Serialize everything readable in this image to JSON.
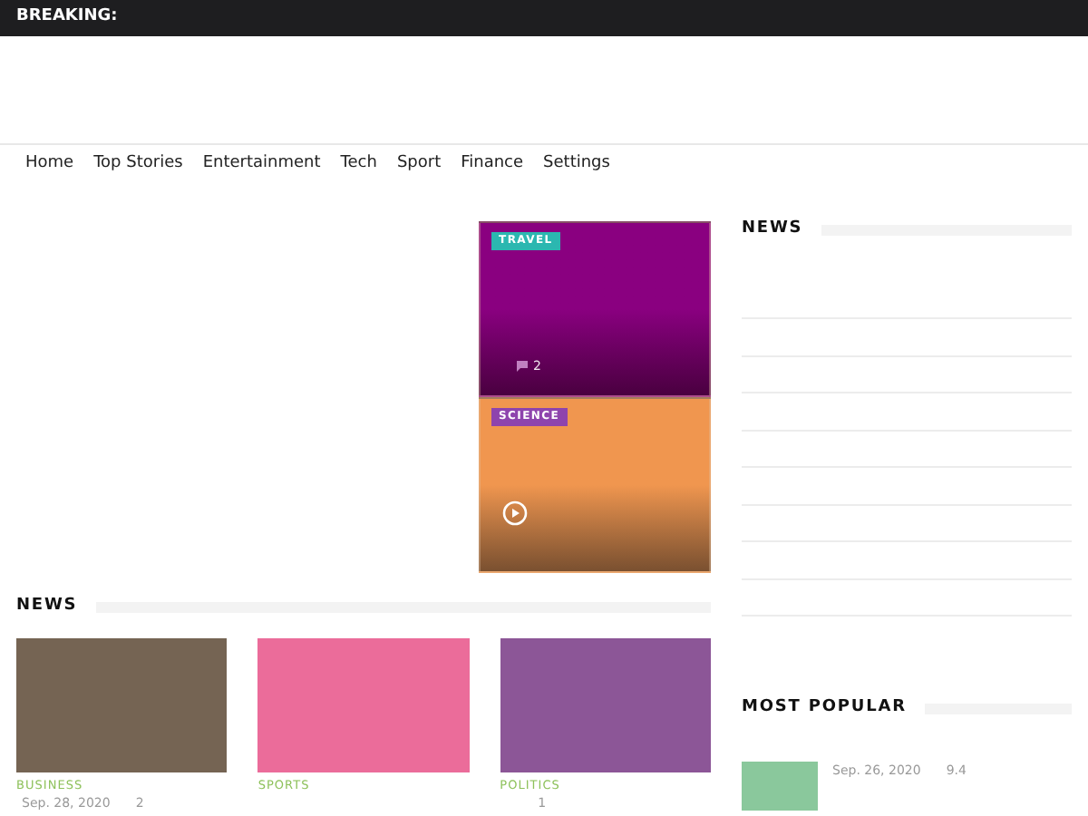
{
  "top_bar": {
    "label": "BREAKING:"
  },
  "nav": [
    {
      "label": "Home"
    },
    {
      "label": "Top Stories"
    },
    {
      "label": "Entertainment"
    },
    {
      "label": "Tech"
    },
    {
      "label": "Sport"
    },
    {
      "label": "Finance"
    },
    {
      "label": "Settings"
    }
  ],
  "featured": [
    {
      "tag": "TRAVEL",
      "comments": "2",
      "kind": "comments"
    },
    {
      "tag": "SCIENCE",
      "kind": "video"
    }
  ],
  "news": {
    "title": "NEWS",
    "items": [
      {
        "color": "#756453",
        "category": "BUSINESS",
        "date": "Sep. 28, 2020",
        "comments": "2"
      },
      {
        "color": "#eb6c9a",
        "category": "SPORTS"
      },
      {
        "color": "#8c5697",
        "category": "POLITICS",
        "comments": "1"
      }
    ]
  },
  "sidebar_news": {
    "title": "NEWS"
  },
  "most_popular": {
    "title": "MOST POPULAR",
    "items": [
      {
        "color": "#8ac89c",
        "date": "Sep. 26, 2020",
        "score": "9.4"
      }
    ]
  }
}
